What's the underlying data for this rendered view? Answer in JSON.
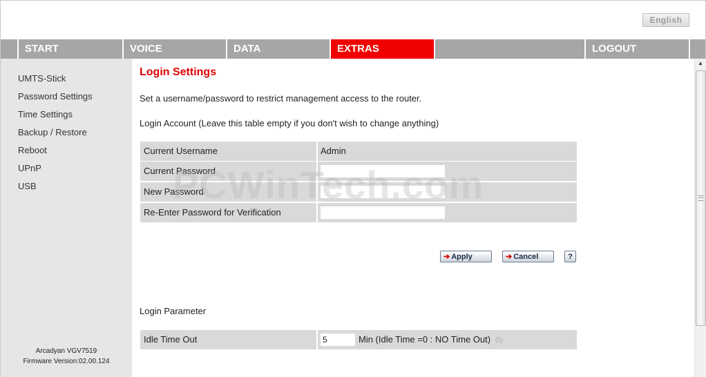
{
  "header": {
    "language_button": "English"
  },
  "nav": {
    "items": [
      {
        "label": "START"
      },
      {
        "label": "VOICE"
      },
      {
        "label": "DATA"
      },
      {
        "label": "EXTRAS",
        "active": true
      },
      {
        "label": "LOGOUT"
      }
    ],
    "active_color": "#f00000",
    "bar_color": "#a6a6a6"
  },
  "sidebar": {
    "items": [
      {
        "label": "UMTS-Stick"
      },
      {
        "label": "Password Settings"
      },
      {
        "label": "Time Settings"
      },
      {
        "label": "Backup / Restore"
      },
      {
        "label": "Reboot"
      },
      {
        "label": "UPnP"
      },
      {
        "label": "USB"
      }
    ],
    "device_model": "Arcadyan VGV7519",
    "firmware": "Firmware Version:02.00.124"
  },
  "main": {
    "title": "Login Settings",
    "description": "Set a username/password to restrict management access to the router.",
    "account_heading": "Login Account (Leave this table empty if you don't wish to change anything)",
    "account_table": {
      "current_username_label": "Current Username",
      "current_username_value": "Admin",
      "current_password_label": "Current Password",
      "new_password_label": "New Password",
      "reenter_password_label": "Re-Enter Password for Verification"
    },
    "buttons": {
      "apply": "Apply",
      "cancel": "Cancel",
      "help": "?"
    },
    "parameter_heading": "Login Parameter",
    "idle": {
      "label": "Idle Time Out",
      "value": "5",
      "unit_text": "Min (Idle Time =0 : NO Time Out)",
      "hint": "(5)"
    },
    "title_color": "#e00000"
  },
  "watermark": "PCWinTech.com"
}
